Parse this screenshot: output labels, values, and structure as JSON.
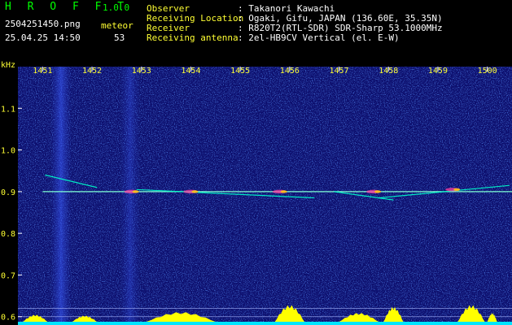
{
  "header": {
    "brand": "H R O F F T",
    "version": "1.0.0",
    "filename": "2504251450.png",
    "datetime": "25.04.25 14:50",
    "meteor_label": "meteor",
    "meteor_count": "53",
    "observer_label": "Observer",
    "observer_value": ": Takanori Kawachi",
    "location_label": "Receiving Location",
    "location_value": ": Ogaki, Gifu, JAPAN (136.60E, 35.35N)",
    "receiver_label": "Receiver",
    "receiver_value": ": R820T2(RTL-SDR) SDR-Sharp 53.1000MHz",
    "antenna_label": "Receiving antenna",
    "antenna_value": ": 2el-HB9CV Vertical (el. E-W)"
  },
  "colors": {
    "background": "#0d0f6e",
    "accent_green": "#00ff00",
    "label_yellow": "#ffff33",
    "trace": "#00ffcc",
    "base_band": "#00e5ff"
  },
  "chart_data": {
    "type": "heatmap",
    "xlabel": "",
    "ylabel": "kHz",
    "x_tick_labels": [
      "1451",
      "1452",
      "1453",
      "1454",
      "1455",
      "1456",
      "1457",
      "1458",
      "1459",
      "1500"
    ],
    "y_tick_labels": [
      "1.1",
      "1.0",
      "0.9",
      "0.8",
      "0.7",
      "0.6"
    ],
    "y_ticks": [
      1.1,
      1.0,
      0.9,
      0.8,
      0.7,
      0.6
    ],
    "ylim": [
      0.58,
      1.2
    ],
    "xlim": [
      0,
      10
    ],
    "grid": false,
    "carrier_line_khz": 0.9,
    "reference_lines_khz": [
      0.62,
      0.6
    ],
    "meteor_traces": [
      {
        "x": [
          0.55,
          1.6
        ],
        "y": [
          0.94,
          0.91
        ]
      },
      {
        "x": [
          2.4,
          6.0
        ],
        "y": [
          0.905,
          0.885
        ]
      },
      {
        "x": [
          6.4,
          7.6
        ],
        "y": [
          0.9,
          0.88
        ]
      },
      {
        "x": [
          7.3,
          9.95
        ],
        "y": [
          0.885,
          0.915
        ]
      }
    ],
    "meteor_hotspots": [
      {
        "x": 2.3,
        "y": 0.9
      },
      {
        "x": 3.5,
        "y": 0.9
      },
      {
        "x": 5.3,
        "y": 0.9
      },
      {
        "x": 7.2,
        "y": 0.9
      },
      {
        "x": 8.8,
        "y": 0.905
      }
    ],
    "level_bursts": [
      {
        "x_start": 0.1,
        "x_end": 0.6,
        "level": 0.4
      },
      {
        "x_start": 1.1,
        "x_end": 1.6,
        "level": 0.35
      },
      {
        "x_start": 2.6,
        "x_end": 4.0,
        "level": 0.55
      },
      {
        "x_start": 5.2,
        "x_end": 5.8,
        "level": 0.95
      },
      {
        "x_start": 6.5,
        "x_end": 7.3,
        "level": 0.5
      },
      {
        "x_start": 7.4,
        "x_end": 7.8,
        "level": 0.85
      },
      {
        "x_start": 8.9,
        "x_end": 9.45,
        "level": 0.95
      },
      {
        "x_start": 9.5,
        "x_end": 9.7,
        "level": 0.5
      }
    ]
  }
}
